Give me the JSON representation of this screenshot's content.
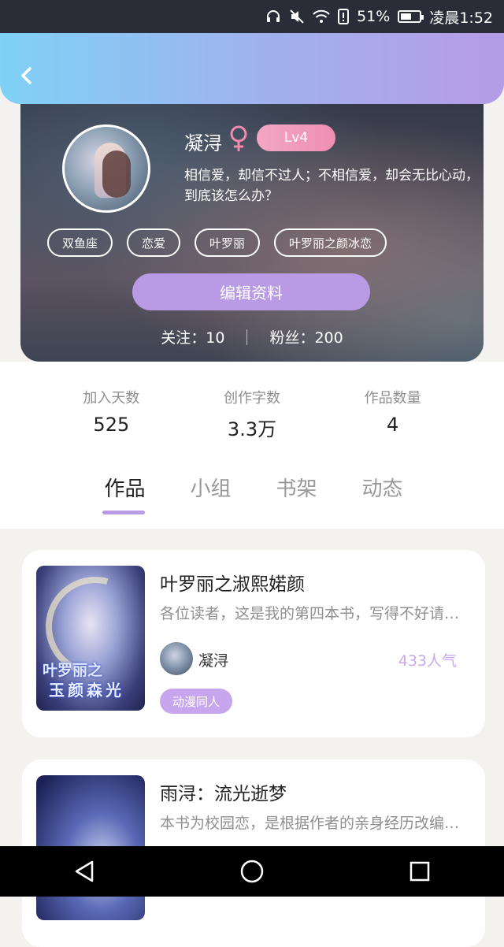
{
  "status_bar": {
    "battery_percent": "51%",
    "time": "凌晨1:52"
  },
  "profile": {
    "username": "凝浔",
    "level": "Lv4",
    "bio": "相信爱，却信不过人；不相信爱，却会无比心动，到底该怎么办？",
    "tags": [
      "双鱼座",
      "恋爱",
      "叶罗丽",
      "叶罗丽之颜冰恋"
    ],
    "edit_label": "编辑资料",
    "following": "关注：10",
    "followers": "粉丝：200"
  },
  "stats": [
    {
      "label": "加入天数",
      "value": "525"
    },
    {
      "label": "创作字数",
      "value": "3.3万"
    },
    {
      "label": "作品数量",
      "value": "4"
    }
  ],
  "tabs": [
    "作品",
    "小组",
    "书架",
    "动态"
  ],
  "active_tab": "作品",
  "books": [
    {
      "title": "叶罗丽之淑熙婼颜",
      "description": "各位读者，这是我的第四本书，写得不好请见谅",
      "author": "凝浔",
      "popularity": "433人气",
      "category": "动漫同人",
      "cover_text_1": "叶罗丽之",
      "cover_text_2": "玉颜森光"
    },
    {
      "title": "雨浔：流光逝梦",
      "description": "本书为校园恋，是根据作者的亲身经历改编而成"
    }
  ],
  "colors": {
    "accent": "#b99ae4",
    "popularity": "#c7a9ee",
    "level_badge": "#ef8fb2",
    "gender_female": "#f08bb0"
  }
}
